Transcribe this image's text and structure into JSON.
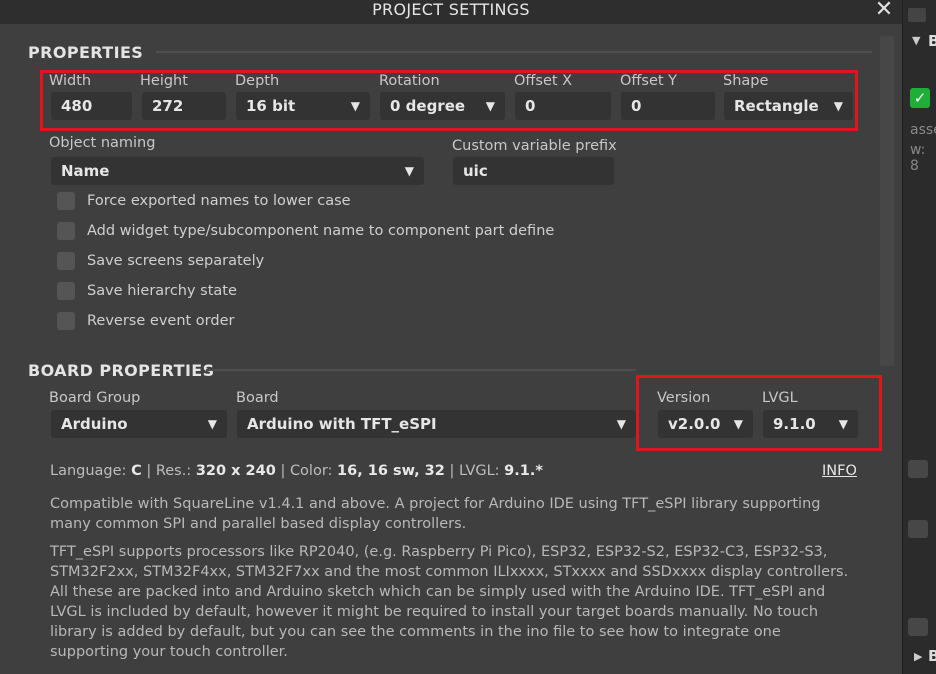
{
  "dialog": {
    "title": "PROJECT SETTINGS",
    "close_glyph": "✕"
  },
  "properties": {
    "section_title": "PROPERTIES",
    "width": {
      "label": "Width",
      "value": "480"
    },
    "height": {
      "label": "Height",
      "value": "272"
    },
    "depth": {
      "label": "Depth",
      "value": "16 bit"
    },
    "rotation": {
      "label": "Rotation",
      "value": "0 degree"
    },
    "offset_x": {
      "label": "Offset X",
      "value": "0"
    },
    "offset_y": {
      "label": "Offset Y",
      "value": "0"
    },
    "shape": {
      "label": "Shape",
      "value": "Rectangle"
    },
    "object_naming": {
      "label": "Object naming",
      "value": "Name"
    },
    "prefix": {
      "label": "Custom variable prefix",
      "value": "uic"
    },
    "checkboxes": [
      "Force exported names to lower case",
      "Add widget type/subcomponent name to component part define",
      "Save screens separately",
      "Save hierarchy state",
      "Reverse event order"
    ]
  },
  "board": {
    "section_title": "BOARD PROPERTIES",
    "group": {
      "label": "Board Group",
      "value": "Arduino"
    },
    "board": {
      "label": "Board",
      "value": "Arduino with TFT_eSPI"
    },
    "version": {
      "label": "Version",
      "value": "v2.0.0"
    },
    "lvgl": {
      "label": "LVGL",
      "value": "9.1.0"
    },
    "summary": {
      "language_label": "Language:",
      "language_value": "C",
      "res_label": "Res.:",
      "res_value": "320 x 240",
      "color_label": "Color:",
      "color_value": "16, 16 sw, 32",
      "lvgl_label": "LVGL:",
      "lvgl_value": "9.1.*",
      "separator": "|"
    },
    "info_link": "INFO",
    "description_1": "Compatible with SquareLine v1.4.1 and above. A project for Arduino IDE using TFT_eSPI library supporting many common SPI and parallel based display controllers.",
    "description_2": "TFT_eSPI supports processors like RP2040, (e.g. Raspberry Pi Pico), ESP32, ESP32-S2, ESP32-C3, ESP32-S3, STM32F2xx, STM32F4xx, STM32F7xx and the most common ILIxxxx, STxxxx and SSDxxxx display controllers. All these are packed into and Arduino sketch which can be simply used with the Arduino IDE. TFT_eSPI and LVGL is included by default, however it might be required to install your target boards manually.  No touch library is added by default, but you can see the comments in the ino file to see how to integrate one supporting your touch controller."
  },
  "background_panel": {
    "section_1": "B",
    "section_2": "B",
    "text_1": "asse",
    "text_2": "w: 8"
  },
  "colors": {
    "highlight_red": "#e0161e",
    "check_green": "#1fae3a"
  }
}
